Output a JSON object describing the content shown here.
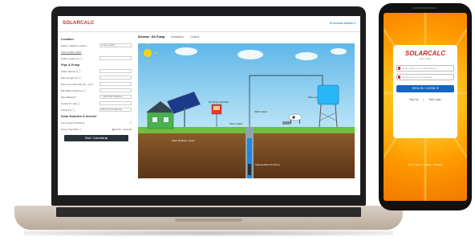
{
  "laptop": {
    "header": {
      "logo": "SOLARCALC",
      "logo_tag": "",
      "user_link": "Hi Anumak Mahato ▾"
    },
    "sidebar": {
      "location_title": "Location",
      "select_location_label": "Select / Search Location",
      "get_location_btn": "⊕ Get Location",
      "submersible_label": "Submersible Cable",
      "cable_length_label": "Cable Length (m) ⓘ",
      "pipe_pump_title": "Pipe & Pump",
      "static_head_label": "Static Head (m) ⓘ",
      "pipe_length_label": "Pipe Length (m) ⓘ",
      "pipe_inner_dia_label": "Pipe Inner Diameter (& - mm)*",
      "min_water_depth_label": "Min Water Depth (m) ⓘ",
      "pipe_material_label": "Pipe Material*",
      "pipe_material_value": "-- Select Pipe Material --",
      "output_label": "Output ft³ / day ⓘ",
      "sizing_for_label": "Sizing For ⓘ",
      "sizing_for_value": "Sizing for average day",
      "solar_modules_title": "Solar Modules & Inverter",
      "use_custom_label": "Use Custom Products",
      "pump_controller_label": "Pump Controller ⓘ",
      "radio_a": "Inbuilt",
      "radio_b": "External",
      "calculate_btn": "Start / Calculate ▶"
    },
    "tabs": [
      {
        "label": "Scheme - DC Pump"
      },
      {
        "label": "Irradiation"
      },
      {
        "label": "Output"
      }
    ],
    "diagram": {
      "solar_modules_label": "Solar Modules / Array",
      "controller_label": "DC Pump Controller",
      "motor_cable_label": "Motor Cable",
      "static_head_label": "Static Head",
      "pipe_length_label": "Pipe Length",
      "pump_label": "Submersible DC Pump"
    }
  },
  "phone": {
    "logo": "SOLARCALC",
    "logo_tag": "solar + water",
    "email_placeholder": "Please enter your email address",
    "password_placeholder": "Please enter your password",
    "signin_btn": "SIGN IN / LOGIN  ➜",
    "signup_link": "Sign Up",
    "startlogin_link": "Start Login",
    "footer": "Terms · Privacy · Contact · Calculator"
  },
  "colors": {
    "brand_red": "#c62828",
    "accent_blue": "#1565c0",
    "phone_orange": "#ff9a00"
  }
}
